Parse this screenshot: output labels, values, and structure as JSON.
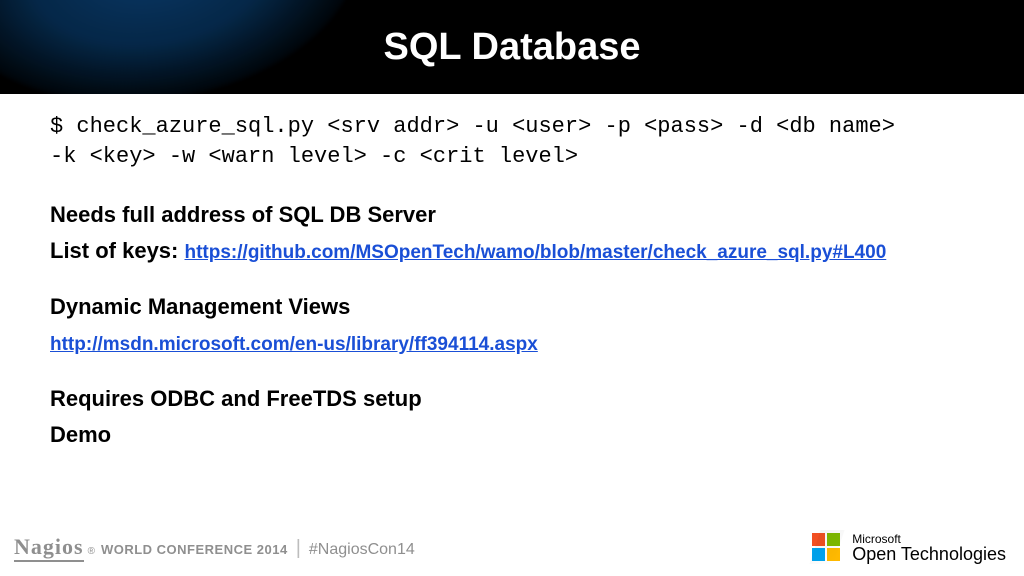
{
  "header": {
    "title": "SQL Database"
  },
  "cmd": "$ check_azure_sql.py <srv addr> -u <user> -p <pass> -d <db name>\n-k <key> -w <warn level> -c <crit level>",
  "body": {
    "needs": "Needs full address of SQL DB Server",
    "keys_label": "List of keys:",
    "keys_url": "https://github.com/MSOpenTech/wamo/blob/master/check_azure_sql.py#L400",
    "dmv": "Dynamic Management Views",
    "dmv_url": "http://msdn.microsoft.com/en-us/library/ff394114.aspx",
    "odbc": "Requires ODBC and FreeTDS setup",
    "demo": "Demo"
  },
  "footer": {
    "nagios": "Nagios",
    "conf": "WORLD CONFERENCE 2014",
    "hashtag": "#NagiosCon14",
    "ms_top": "Microsoft",
    "ms_bot": "Open Technologies"
  }
}
